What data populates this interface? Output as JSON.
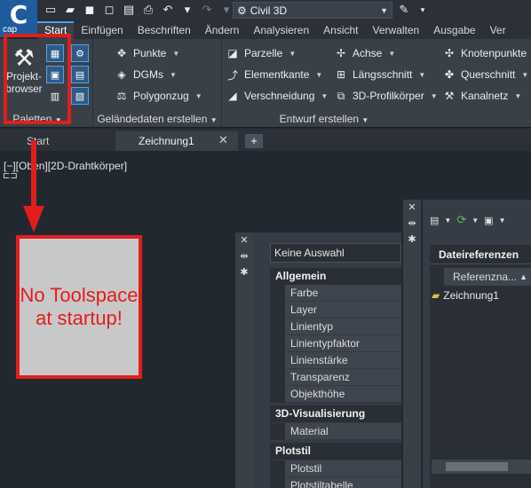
{
  "app": {
    "logo_letter": "C",
    "logo_caption": "cap"
  },
  "quick_access": {
    "workspace": "Civil 3D"
  },
  "ribbon_tabs": [
    "Start",
    "Einfügen",
    "Beschriften",
    "Ändern",
    "Analysieren",
    "Ansicht",
    "Verwalten",
    "Ausgabe",
    "Ver"
  ],
  "panels": {
    "paletten": {
      "title": "Paletten",
      "prospector_label": "Projekt-\nbrowser"
    },
    "gelaende": {
      "title": "Geländedaten erstellen",
      "items": [
        "Punkte",
        "DGMs",
        "Polygonzug"
      ]
    },
    "entwurf": {
      "title": "Entwurf erstellen",
      "items": [
        "Parzelle",
        "Elementkante",
        "Verschneidung",
        "Achse",
        "Längsschnitt",
        "3D-Profilkörper",
        "Knotenpunkte",
        "Querschnitt",
        "Kanalnetz"
      ]
    }
  },
  "doc_tabs": [
    "Start",
    "Zeichnung1"
  ],
  "viewport_label": "[−][Oben][2D-Drahtkörper]",
  "annotation": {
    "note": "No Toolspace at startup!"
  },
  "properties": {
    "selection": "Keine Auswahl",
    "categories": [
      "Allgemein",
      "3D-Visualisierung",
      "Plotstil"
    ],
    "allgemein": [
      "Farbe",
      "Layer",
      "Linientyp",
      "Linientypfaktor",
      "Linienstärke",
      "Transparenz",
      "Objekthöhe"
    ],
    "visual": [
      "Material"
    ],
    "plotstil": [
      "Plotstil",
      "Plotstiltabelle"
    ]
  },
  "references": {
    "title": "Dateireferenzen",
    "column": "Referenzna...",
    "item": "Zeichnung1"
  },
  "colors": {
    "accent": "#4aa0e8",
    "annotation_red": "#e21d1d"
  }
}
